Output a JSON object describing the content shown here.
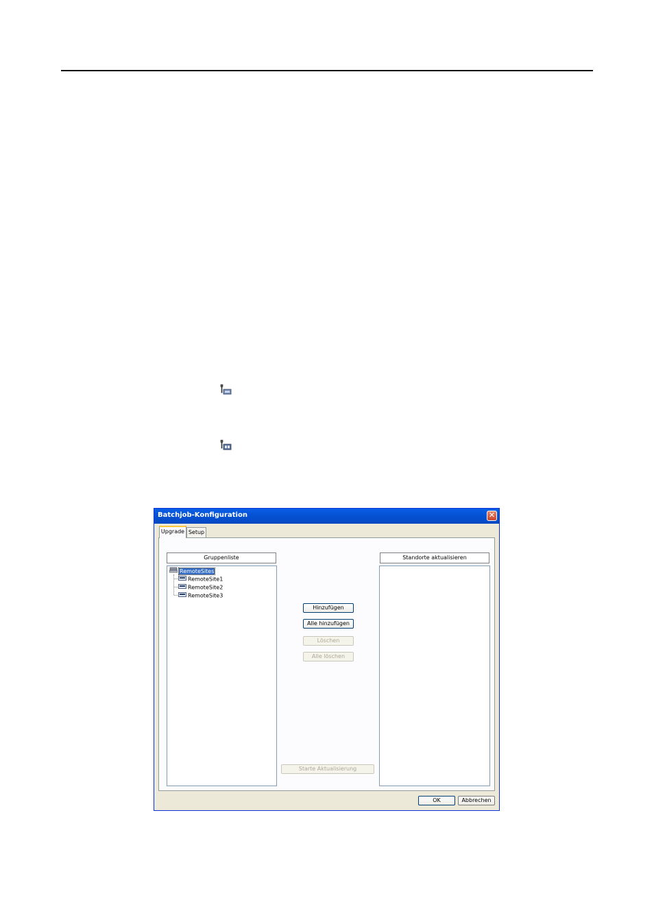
{
  "document": {
    "icons": [
      "wrench-device-icon",
      "wrench-device-alt-icon"
    ]
  },
  "dialog": {
    "title": "Batchjob-Konfiguration",
    "close_label": "✕",
    "tabs": [
      {
        "label": "Upgrade",
        "active": true
      },
      {
        "label": "Setup",
        "active": false
      }
    ],
    "group_list": {
      "header": "Gruppenliste",
      "root": {
        "label": "RemoteSites",
        "icon": "group-icon"
      },
      "children": [
        {
          "label": "RemoteSite1",
          "icon": "device-icon"
        },
        {
          "label": "RemoteSite2",
          "icon": "device-icon"
        },
        {
          "label": "RemoteSite3",
          "icon": "device-icon"
        }
      ]
    },
    "update_sites": {
      "header": "Standorte aktualisieren"
    },
    "buttons": {
      "add": "Hinzufügen",
      "add_all": "Alle hinzufügen",
      "delete": "Löschen",
      "delete_all": "Alle löschen",
      "start_update": "Starte Aktualisierung",
      "ok": "OK",
      "cancel": "Abbrechen"
    }
  }
}
